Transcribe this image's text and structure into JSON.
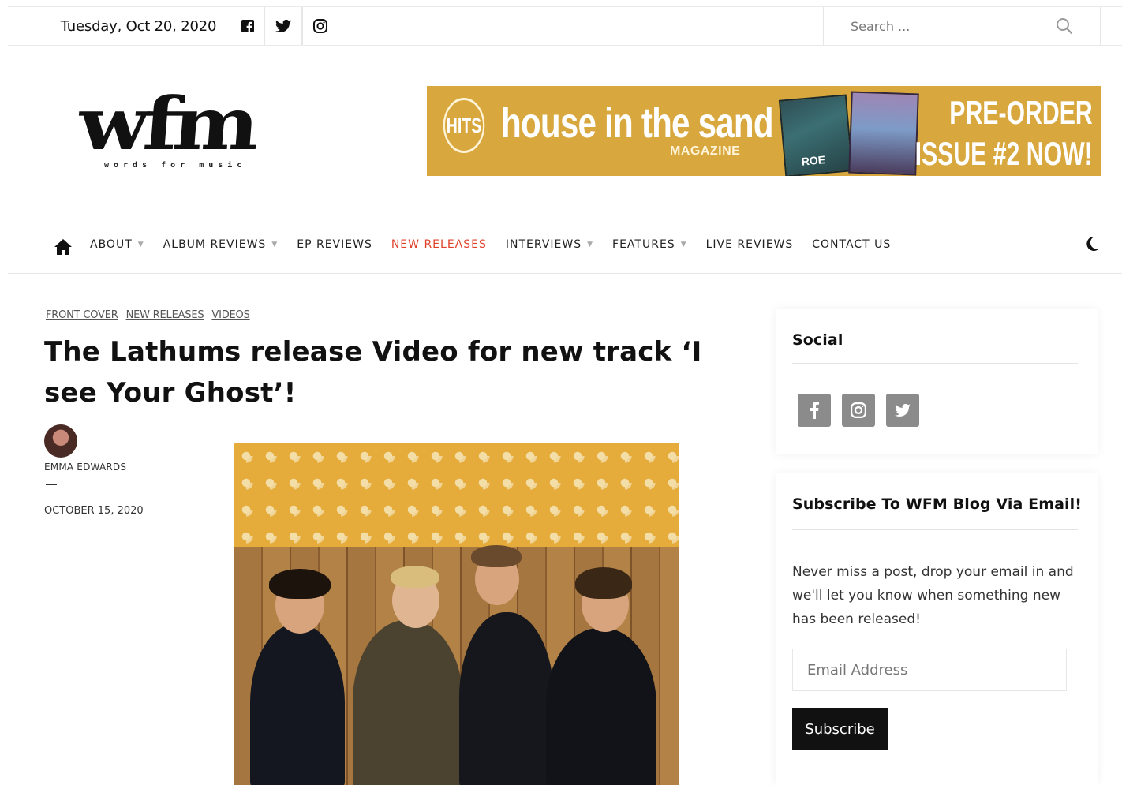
{
  "topbar": {
    "date": "Tuesday, Oct 20, 2020",
    "social_icons": [
      "facebook-icon",
      "twitter-icon",
      "instagram-icon"
    ],
    "search_placeholder": "Search ..."
  },
  "header": {
    "logo_text": "wfm",
    "logo_tagline": "words for music",
    "banner": {
      "badge": "HITS",
      "brand": "house in the sand",
      "sub": "MAGAZINE",
      "cover_label": "ROE",
      "cta_line1": "PRE-ORDER",
      "cta_line2": "ISSUE #2 NOW!"
    }
  },
  "nav": {
    "items": [
      {
        "label": "ABOUT",
        "dropdown": true
      },
      {
        "label": "ALBUM REVIEWS",
        "dropdown": true
      },
      {
        "label": "EP REVIEWS",
        "dropdown": false
      },
      {
        "label": "NEW RELEASES",
        "dropdown": false,
        "active": true
      },
      {
        "label": "INTERVIEWS",
        "dropdown": true
      },
      {
        "label": "FEATURES",
        "dropdown": true
      },
      {
        "label": "LIVE REVIEWS",
        "dropdown": false
      },
      {
        "label": "CONTACT US",
        "dropdown": false
      }
    ]
  },
  "article": {
    "categories": [
      "FRONT COVER",
      "NEW RELEASES",
      "VIDEOS"
    ],
    "title": "The Lathums release Video for new track ‘I see Your Ghost’!",
    "author": "EMMA EDWARDS",
    "date": "OCTOBER 15, 2020"
  },
  "sidebar": {
    "social_title": "Social",
    "social_buttons": [
      "facebook-icon",
      "instagram-icon",
      "twitter-icon"
    ],
    "subscribe_title": "Subscribe To WFM Blog Via Email!",
    "subscribe_text": "Never miss a post, drop your email in and we'll let you know when something new has been released!",
    "email_placeholder": "Email Address",
    "subscribe_button": "Subscribe"
  },
  "colors": {
    "accent_active": "#e0412b",
    "banner": "#d8a83e",
    "button": "#111111",
    "social_button": "#8b8b8b"
  }
}
